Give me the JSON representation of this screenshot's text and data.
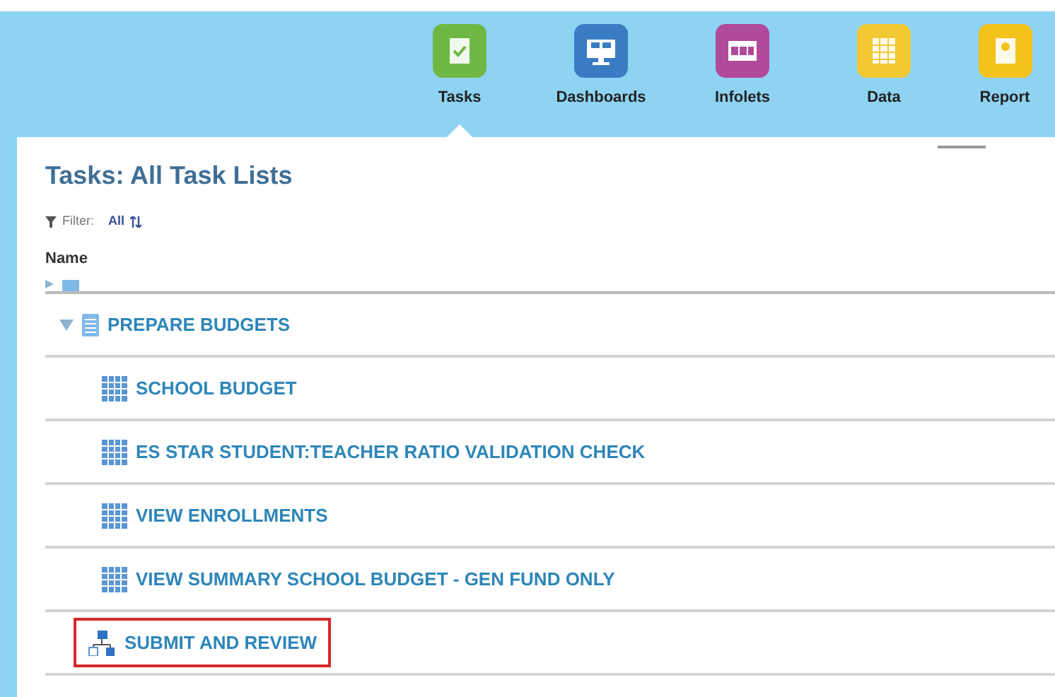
{
  "nav": [
    {
      "label": "Tasks",
      "kind": "tasks",
      "selected": true
    },
    {
      "label": "Dashboards",
      "kind": "dashboards",
      "selected": false
    },
    {
      "label": "Infolets",
      "kind": "infolets",
      "selected": false
    },
    {
      "label": "Data",
      "kind": "data",
      "selected": false
    },
    {
      "label": "Report",
      "kind": "reports",
      "selected": false
    }
  ],
  "title": "Tasks: All Task Lists",
  "filter": {
    "label": "Filter:",
    "value": "All"
  },
  "column": "Name",
  "tasks": [
    {
      "kind": "list",
      "label": "PREPARE BUDGETS",
      "expanded": true,
      "children": [
        {
          "kind": "form",
          "label": "SCHOOL BUDGET",
          "highlighted": false
        },
        {
          "kind": "form",
          "label": "ES STAR STUDENT:TEACHER RATIO VALIDATION CHECK",
          "highlighted": false
        },
        {
          "kind": "form",
          "label": "VIEW ENROLLMENTS",
          "highlighted": false
        },
        {
          "kind": "form",
          "label": "VIEW SUMMARY SCHOOL BUDGET - GEN FUND ONLY",
          "highlighted": false
        },
        {
          "kind": "flow",
          "label": "SUBMIT AND REVIEW",
          "highlighted": true
        }
      ]
    }
  ]
}
